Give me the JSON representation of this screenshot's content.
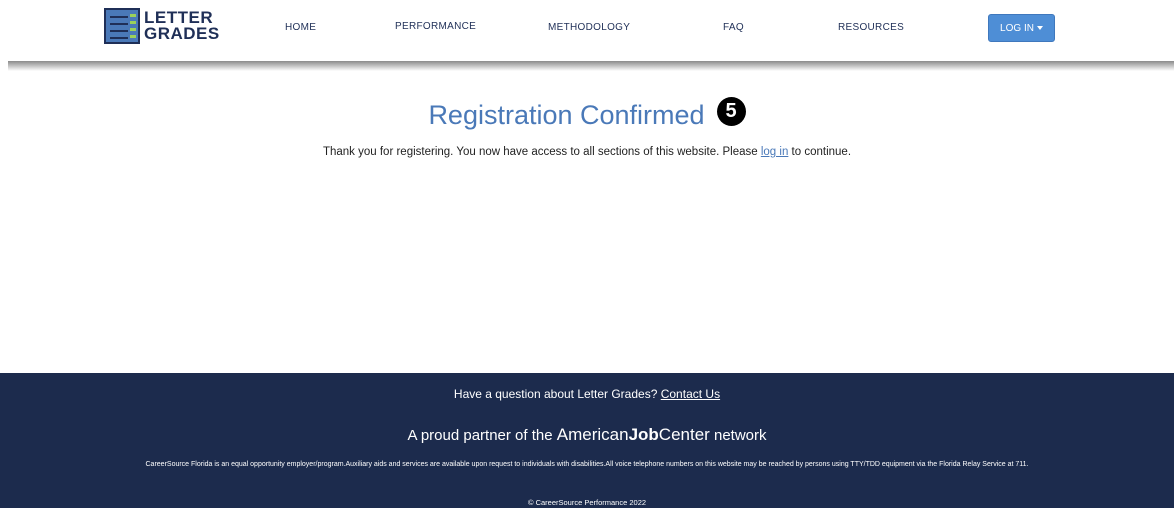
{
  "logo": {
    "line1": "LETTER",
    "line2": "GRADES"
  },
  "nav": {
    "home": "HOME",
    "performance": "PERFORMANCE",
    "methodology": "METHODOLOGY",
    "faq": "FAQ",
    "resources": "RESOURCES",
    "login": "LOG IN"
  },
  "main": {
    "title": "Registration Confirmed",
    "step_number": "5",
    "message_before": "Thank you for registering. You now have access to all sections of this website. Please ",
    "message_link": "log in",
    "message_after": " to continue."
  },
  "footer": {
    "question": "Have a question about Letter Grades? ",
    "contact_link": "Contact Us",
    "partner_before": "A proud partner of the ",
    "ajc_american": "American",
    "ajc_job": "Job",
    "ajc_center": "Center",
    "partner_after": " network",
    "legal": "CareerSource Florida is an equal opportunity employer/program.Auxiliary aids and services are available upon request to individuals with disabilities.All voice telephone numbers on this website may be reached by persons using TTY/TDD equipment via the Florida Relay Service at 711.",
    "copyright": "© CareerSource Performance 2022"
  },
  "colors": {
    "brand_blue": "#4a79b8",
    "navy": "#1c2b4d",
    "button_blue": "#4e8ed6"
  }
}
